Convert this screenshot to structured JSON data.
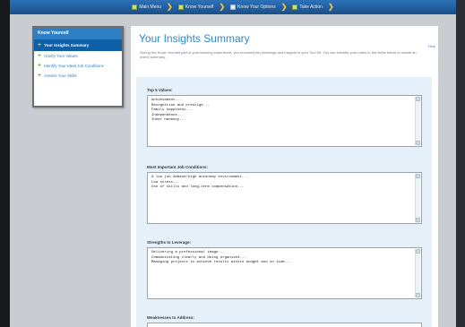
{
  "window": {
    "title": "Your Insights Summary"
  },
  "nav": {
    "steps": [
      {
        "label": "Main Menu",
        "state": "done"
      },
      {
        "label": "Know Yourself",
        "state": "done"
      },
      {
        "label": "Know Your Options",
        "state": "current"
      },
      {
        "label": "Take Action",
        "state": "todo"
      }
    ]
  },
  "sidebar": {
    "header": "Know Yourself",
    "items": [
      {
        "label": "Your Insights Summary",
        "active": true
      },
      {
        "label": "Clarify Your Values",
        "active": false
      },
      {
        "label": "Identify Your Ideal Job Conditions",
        "active": false
      },
      {
        "label": "Assess Your Skills",
        "active": false
      }
    ]
  },
  "main": {
    "title": "Your Insights Summary",
    "help_link": "Help",
    "intro": "During the Know Yourself part of your learning experience, you recorded key learnings and insights in your Tool Kit. You can transfer your notes to the fields below to create an online summary.",
    "fields": [
      {
        "label": "Top 5 Values:",
        "lines": [
          "Achievement...",
          "Recognition and prestige...",
          "Family happiness...",
          "Independence...",
          "Inner harmony..."
        ]
      },
      {
        "label": "Most Important Job Conditions:",
        "lines": [
          "A low job demand/high autonomy environment...",
          "Low stress...",
          "Use of skills and long-term compensation..."
        ]
      },
      {
        "label": "Strengths to Leverage:",
        "lines": [
          "Delivering a professional image...",
          "Communicating clearly and being organized...",
          "Managing projects to achieve results within budget and on time..."
        ]
      },
      {
        "label": "Weaknesses to Address:",
        "lines": []
      }
    ]
  },
  "colors": {
    "accent": "#2d86d0",
    "nav_bar": "#1f5fa3",
    "sidebar_header": "#2f7fc7",
    "sidebar_active": "#0f5fa6",
    "form_bg": "#e6f0f8"
  }
}
